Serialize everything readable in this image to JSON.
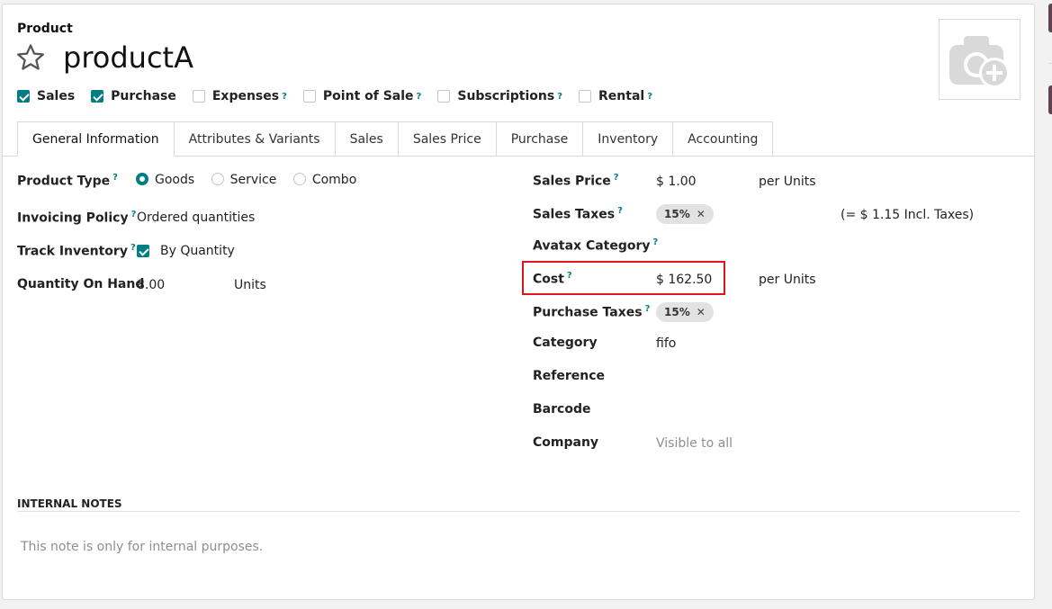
{
  "header": {
    "label": "Product",
    "name": "productA"
  },
  "flags": [
    {
      "label": "Sales",
      "checked": true,
      "help": ""
    },
    {
      "label": "Purchase",
      "checked": true,
      "help": ""
    },
    {
      "label": "Expenses",
      "checked": false,
      "help": "?"
    },
    {
      "label": "Point of Sale",
      "checked": false,
      "help": "?"
    },
    {
      "label": "Subscriptions",
      "checked": false,
      "help": "?"
    },
    {
      "label": "Rental",
      "checked": false,
      "help": "?"
    }
  ],
  "tabs": [
    "General Information",
    "Attributes & Variants",
    "Sales",
    "Sales Price",
    "Purchase",
    "Inventory",
    "Accounting"
  ],
  "left": {
    "product_type": {
      "label": "Product Type",
      "help": "?",
      "options": [
        "Goods",
        "Service",
        "Combo"
      ],
      "selected": "Goods"
    },
    "invoicing_policy": {
      "label": "Invoicing Policy",
      "help": "?",
      "value": "Ordered quantities"
    },
    "track_inventory": {
      "label": "Track Inventory",
      "help": "?",
      "value": "By Quantity",
      "checked": true
    },
    "quantity": {
      "label": "Quantity On Hand",
      "value": "8.00",
      "unit": "Units"
    }
  },
  "right": {
    "sales_price": {
      "label": "Sales Price",
      "help": "?",
      "value": "$ 1.00",
      "per": "per Units"
    },
    "sales_taxes": {
      "label": "Sales Taxes",
      "help": "?",
      "tag": "15%",
      "incl": "(= $ 1.15 Incl. Taxes)"
    },
    "avatax": {
      "label": "Avatax Category",
      "help": "?"
    },
    "cost": {
      "label": "Cost",
      "help": "?",
      "value": "$ 162.50",
      "per": "per Units"
    },
    "purchase_taxes": {
      "label": "Purchase Taxes",
      "help": "?",
      "tag": "15%"
    },
    "category": {
      "label": "Category",
      "value": "fifo"
    },
    "reference": {
      "label": "Reference"
    },
    "barcode": {
      "label": "Barcode"
    },
    "company": {
      "label": "Company",
      "value": "Visible to all"
    }
  },
  "notes": {
    "title": "INTERNAL NOTES",
    "placeholder": "This note is only for internal purposes."
  },
  "colors": {
    "accent": "#017e84",
    "highlight": "#e0161b"
  },
  "icons": {
    "favorite": "star-icon",
    "photo": "camera-plus-icon",
    "remove_tag": "x-icon"
  }
}
